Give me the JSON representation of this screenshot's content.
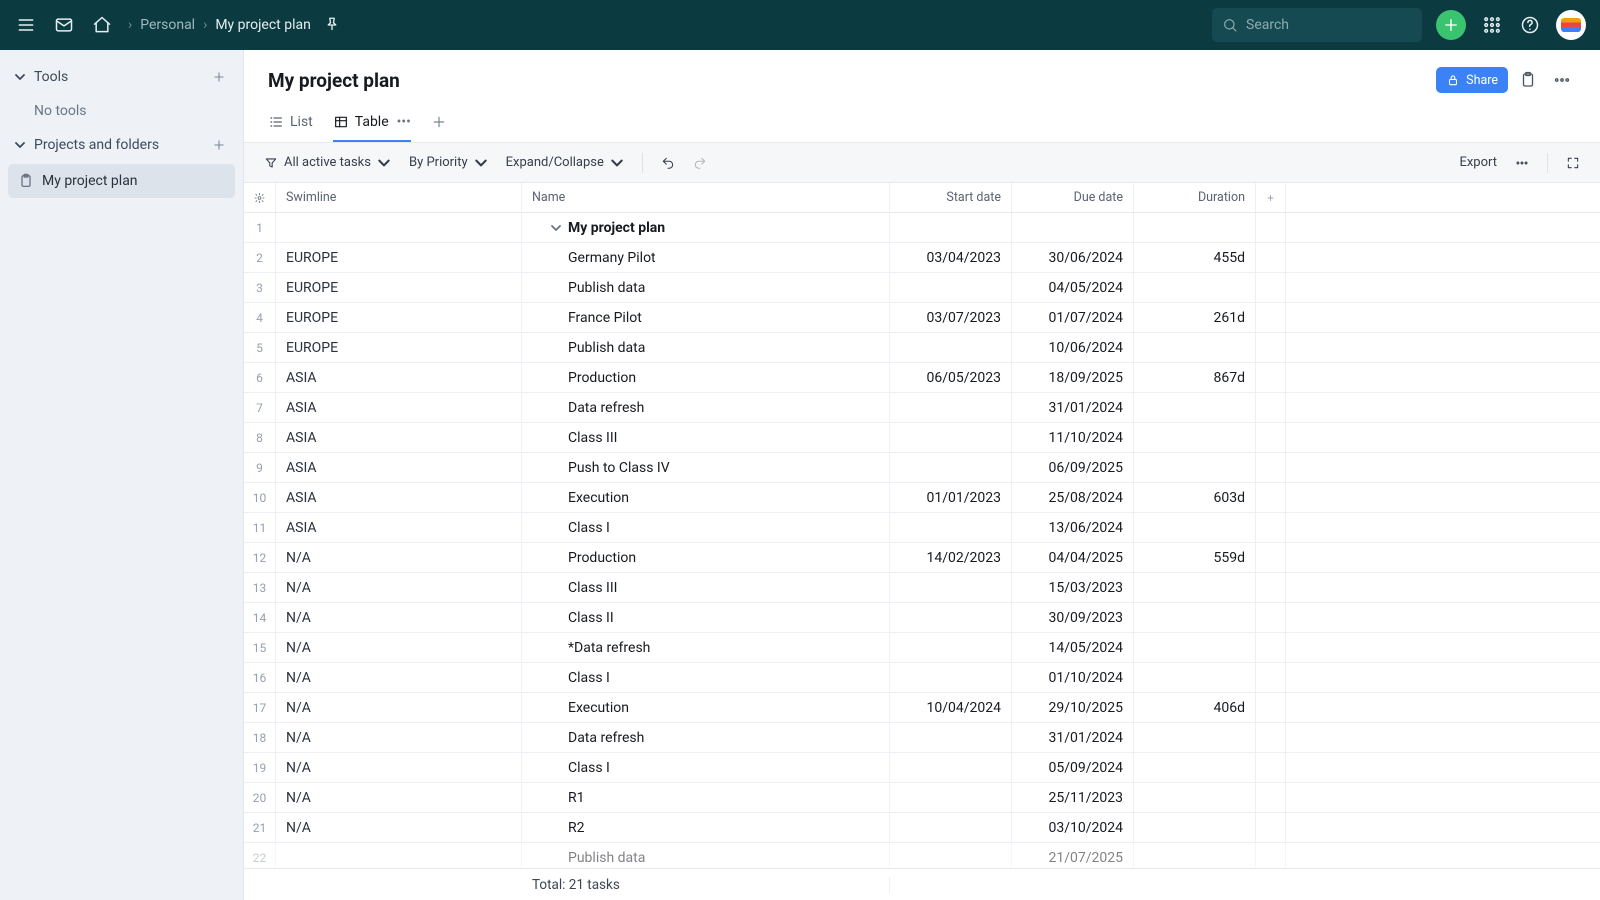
{
  "topbar": {
    "breadcrumb_root": "Personal",
    "breadcrumb_current": "My project plan",
    "search_placeholder": "Search"
  },
  "sidebar": {
    "tools_label": "Tools",
    "no_tools": "No tools",
    "projects_label": "Projects and folders",
    "project_item": "My project plan"
  },
  "header": {
    "title": "My project plan",
    "share_label": "Share"
  },
  "tabs": {
    "list": "List",
    "table": "Table"
  },
  "toolbar": {
    "filter": "All active tasks",
    "sort": "By Priority",
    "expand": "Expand/Collapse",
    "export": "Export"
  },
  "columns": {
    "swimline": "Swimline",
    "name": "Name",
    "start": "Start date",
    "due": "Due date",
    "duration": "Duration"
  },
  "group_name": "My project plan",
  "rows": [
    {
      "n": 2,
      "swim": "EUROPE",
      "name": "Germany Pilot",
      "start": "03/04/2023",
      "due": "30/06/2024",
      "dur": "455d"
    },
    {
      "n": 3,
      "swim": "EUROPE",
      "name": "Publish data",
      "start": "",
      "due": "04/05/2024",
      "dur": ""
    },
    {
      "n": 4,
      "swim": "EUROPE",
      "name": "France Pilot",
      "start": "03/07/2023",
      "due": "01/07/2024",
      "dur": "261d"
    },
    {
      "n": 5,
      "swim": "EUROPE",
      "name": "Publish data",
      "start": "",
      "due": "10/06/2024",
      "dur": ""
    },
    {
      "n": 6,
      "swim": "ASIA",
      "name": "Production",
      "start": "06/05/2023",
      "due": "18/09/2025",
      "dur": "867d"
    },
    {
      "n": 7,
      "swim": "ASIA",
      "name": "Data refresh",
      "start": "",
      "due": "31/01/2024",
      "dur": ""
    },
    {
      "n": 8,
      "swim": "ASIA",
      "name": "Class III",
      "start": "",
      "due": "11/10/2024",
      "dur": ""
    },
    {
      "n": 9,
      "swim": "ASIA",
      "name": "Push to Class IV",
      "start": "",
      "due": "06/09/2025",
      "dur": ""
    },
    {
      "n": 10,
      "swim": "ASIA",
      "name": "Execution",
      "start": "01/01/2023",
      "due": "25/08/2024",
      "dur": "603d"
    },
    {
      "n": 11,
      "swim": "ASIA",
      "name": "Class I",
      "start": "",
      "due": "13/06/2024",
      "dur": ""
    },
    {
      "n": 12,
      "swim": "N/A",
      "name": "Production",
      "start": "14/02/2023",
      "due": "04/04/2025",
      "dur": "559d"
    },
    {
      "n": 13,
      "swim": "N/A",
      "name": "Class III",
      "start": "",
      "due": "15/03/2023",
      "dur": ""
    },
    {
      "n": 14,
      "swim": "N/A",
      "name": "Class II",
      "start": "",
      "due": "30/09/2023",
      "dur": ""
    },
    {
      "n": 15,
      "swim": "N/A",
      "name": "*Data refresh",
      "start": "",
      "due": "14/05/2024",
      "dur": ""
    },
    {
      "n": 16,
      "swim": "N/A",
      "name": "Class I",
      "start": "",
      "due": "01/10/2024",
      "dur": ""
    },
    {
      "n": 17,
      "swim": "N/A",
      "name": "Execution",
      "start": "10/04/2024",
      "due": "29/10/2025",
      "dur": "406d"
    },
    {
      "n": 18,
      "swim": "N/A",
      "name": "Data refresh",
      "start": "",
      "due": "31/01/2024",
      "dur": ""
    },
    {
      "n": 19,
      "swim": "N/A",
      "name": "Class I",
      "start": "",
      "due": "05/09/2024",
      "dur": ""
    },
    {
      "n": 20,
      "swim": "N/A",
      "name": "R1",
      "start": "",
      "due": "25/11/2023",
      "dur": ""
    },
    {
      "n": 21,
      "swim": "N/A",
      "name": "R2",
      "start": "",
      "due": "03/10/2024",
      "dur": ""
    },
    {
      "n": 22,
      "swim": "",
      "name": "Publish data",
      "start": "",
      "due": "21/07/2025",
      "dur": ""
    }
  ],
  "footer": {
    "total": "Total: 21 tasks"
  }
}
